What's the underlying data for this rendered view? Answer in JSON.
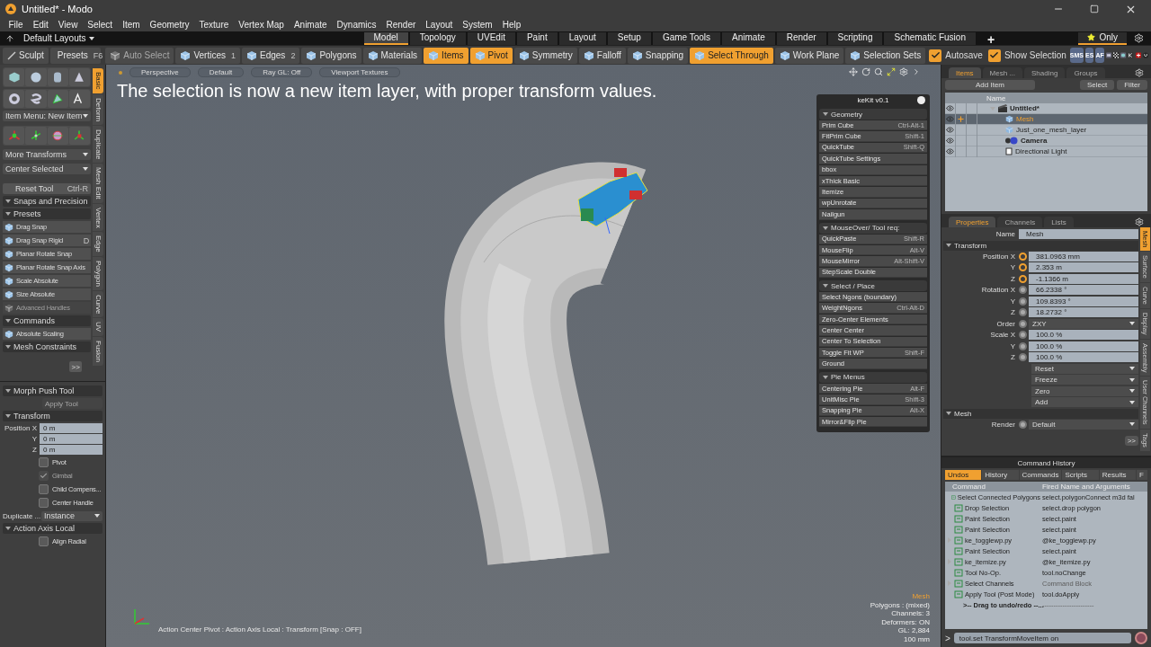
{
  "window": {
    "title": "Untitled* - Modo"
  },
  "menu": [
    "File",
    "Edit",
    "View",
    "Select",
    "Item",
    "Geometry",
    "Texture",
    "Vertex Map",
    "Animate",
    "Dynamics",
    "Render",
    "Layout",
    "System",
    "Help"
  ],
  "layout_bar": {
    "layouts": "Default Layouts",
    "tabs": [
      {
        "label": "Model",
        "selected": true
      },
      {
        "label": "Topology",
        "selected": false
      },
      {
        "label": "UVEdit",
        "selected": false
      },
      {
        "label": "Paint",
        "selected": false
      },
      {
        "label": "Layout",
        "selected": false
      },
      {
        "label": "Setup",
        "selected": false
      },
      {
        "label": "Game Tools",
        "selected": false
      },
      {
        "label": "Animate",
        "selected": false
      },
      {
        "label": "Render",
        "selected": false
      },
      {
        "label": "Scripting",
        "selected": false
      },
      {
        "label": "Schematic Fusion",
        "selected": false
      }
    ],
    "add": "+",
    "only": "Only"
  },
  "left_toolbar": [
    {
      "label": "Sculpt"
    },
    {
      "label": "Presets",
      "shortcut": "F6"
    }
  ],
  "toolbar": [
    {
      "label": "Auto Select",
      "selected": false,
      "disabled": true
    },
    {
      "label": "Vertices",
      "shortcut": "1",
      "selected": false,
      "disabled": false
    },
    {
      "label": "Edges",
      "shortcut": "2",
      "selected": false,
      "disabled": false
    },
    {
      "label": "Polygons",
      "selected": false,
      "disabled": false
    },
    {
      "label": "Materials",
      "selected": false,
      "disabled": false
    },
    {
      "label": "Items",
      "selected": true,
      "disabled": false
    },
    {
      "label": "Pivot",
      "selected": true,
      "disabled": false
    },
    {
      "label": "Symmetry",
      "selected": false,
      "disabled": false
    },
    {
      "label": "Falloff",
      "selected": false,
      "disabled": false
    },
    {
      "label": "Snapping",
      "selected": false,
      "disabled": false
    },
    {
      "label": "Select Through",
      "selected": true,
      "disabled": false
    },
    {
      "label": "Work Plane",
      "selected": false,
      "disabled": false
    },
    {
      "label": "Selection Sets",
      "selected": false,
      "disabled": false
    }
  ],
  "toggles": [
    {
      "label": "Autosave",
      "checked": true
    },
    {
      "label": "Show Selection",
      "checked": true
    }
  ],
  "icon_buttons": [
    "SMS",
    "ES",
    "AF"
  ],
  "left_panel": {
    "item_menu": "Item Menu: New Item",
    "dropdowns": [
      "More Transforms",
      "Center Selected"
    ],
    "reset": {
      "label": "Reset Tool",
      "shortcut": "Ctrl-R"
    },
    "tools": [
      {
        "kind": "header",
        "label": "Snaps and Precision"
      },
      {
        "kind": "header",
        "label": "Presets"
      },
      {
        "kind": "item",
        "label": "Drag Snap",
        "disabled": false
      },
      {
        "kind": "item",
        "label": "Drag Snap Rigid",
        "shortcut": "D",
        "disabled": false
      },
      {
        "kind": "item",
        "label": "Planar Rotate Snap",
        "disabled": false
      },
      {
        "kind": "item",
        "label": "Planar Rotate Snap Axis",
        "disabled": false
      },
      {
        "kind": "item",
        "label": "Scale Absolute",
        "disabled": false
      },
      {
        "kind": "item",
        "label": "Size Absolute",
        "disabled": false
      },
      {
        "kind": "item",
        "label": "Advanced Handles",
        "disabled": true
      },
      {
        "kind": "header",
        "label": "Commands"
      },
      {
        "kind": "item",
        "label": "Absolute Scaling",
        "disabled": false
      },
      {
        "kind": "header",
        "label": "Mesh Constraints"
      }
    ],
    "more": ">>",
    "tabs": [
      {
        "label": "Basic",
        "selected": true
      },
      {
        "label": "Deform",
        "selected": false
      },
      {
        "label": "Duplicate",
        "selected": false
      },
      {
        "label": "Mesh Edit",
        "selected": false
      },
      {
        "label": "Vertex",
        "selected": false
      },
      {
        "label": "Edge",
        "selected": false
      },
      {
        "label": "Polygon",
        "selected": false
      },
      {
        "label": "Curve",
        "selected": false
      },
      {
        "label": "UV",
        "selected": false
      },
      {
        "label": "Fusion",
        "selected": false
      }
    ],
    "tool_props": {
      "title": "Morph Push Tool",
      "apply": "Apply Tool",
      "transform": "Transform",
      "position": [
        {
          "label": "Position X",
          "value": "0 m"
        },
        {
          "label": "Y",
          "value": "0 m"
        },
        {
          "label": "Z",
          "value": "0 m"
        }
      ],
      "checks": [
        {
          "label": "Pivot",
          "checked": false,
          "disabled": false
        },
        {
          "label": "Gimbal",
          "checked": true,
          "disabled": true
        },
        {
          "label": "Child Compens...",
          "checked": false,
          "disabled": false
        },
        {
          "label": "Center Handle",
          "checked": false,
          "disabled": false
        }
      ],
      "duplicate": {
        "label": "Duplicate ...",
        "value": "Instance"
      },
      "axis_title": "Action Axis Local",
      "align": {
        "label": "Align Radial",
        "checked": false
      }
    }
  },
  "viewport": {
    "header": [
      "Perspective",
      "Default",
      "Ray GL: Off",
      "Viewport Textures"
    ],
    "caption": "The selection is now a new item layer, with proper transform values.",
    "status": "Action Center Pivot : Action Axis Local : Transform  [Snap : OFF]",
    "stats": [
      "Mesh",
      "Polygons : (mixed)",
      "Channels: 3",
      "Deformers: ON",
      "GL: 2,884",
      "100 mm"
    ]
  },
  "kit": {
    "title": "keKit v0.1",
    "sections": [
      {
        "title": "Geometry",
        "items": [
          {
            "label": "Prim Cube",
            "shortcut": "Ctrl-Alt-1"
          },
          {
            "label": "FitPrim Cube",
            "shortcut": "Shift-1"
          },
          {
            "label": "QuickTube",
            "shortcut": "Shift-Q"
          },
          {
            "label": "QuickTube Settings"
          },
          {
            "label": "bbox"
          },
          {
            "label": "xThick Basic"
          },
          {
            "label": "Itemize"
          },
          {
            "label": "wpUnrotate"
          },
          {
            "label": "Nailgun"
          }
        ]
      },
      {
        "title": "MouseOver/ Tool req:",
        "items": [
          {
            "label": "QuickPaste",
            "shortcut": "Shift-R"
          },
          {
            "label": "MouseFlip",
            "shortcut": "Alt-V"
          },
          {
            "label": "MouseMirror",
            "shortcut": "Alt-Shift-V"
          },
          {
            "label": "StepScale Double"
          }
        ]
      },
      {
        "title": "Select / Place",
        "items": [
          {
            "label": "Select Ngons (boundary)"
          },
          {
            "label": "WeightNgons",
            "shortcut": "Ctrl-Alt-D"
          },
          {
            "label": "Zero-Center Elements"
          },
          {
            "label": "Center Center"
          },
          {
            "label": "Center To Selection"
          },
          {
            "label": "Toggle Fit WP",
            "shortcut": "Shift-F"
          },
          {
            "label": "Ground"
          }
        ]
      },
      {
        "title": "Pie Menus",
        "items": [
          {
            "label": "Centering Pie",
            "shortcut": "Alt-F"
          },
          {
            "label": "UnitMisc Pie",
            "shortcut": "Shift-3"
          },
          {
            "label": "Snapping Pie",
            "shortcut": "Alt-X"
          },
          {
            "label": "Mirror&Flip Pie"
          }
        ]
      }
    ]
  },
  "items_panel": {
    "tabs": [
      {
        "label": "Items",
        "selected": true
      },
      {
        "label": "Mesh ...",
        "selected": false
      },
      {
        "label": "Shading",
        "selected": false
      },
      {
        "label": "Groups",
        "selected": false
      }
    ],
    "add_item": "Add Item",
    "select": "Select",
    "filter": "Filter",
    "name_column": "Name",
    "tree": [
      {
        "label": "Untitled*",
        "kind": "scene",
        "bold": true,
        "selected": false,
        "children": [
          {
            "label": "Mesh",
            "kind": "mesh",
            "bold": false,
            "selected": true
          },
          {
            "label": "Just_one_mesh_layer",
            "kind": "mesh",
            "bold": false,
            "selected": false
          },
          {
            "label": "Camera",
            "kind": "camera",
            "bold": true,
            "selected": false
          },
          {
            "label": "Directional Light",
            "kind": "light",
            "bold": false,
            "selected": false
          }
        ]
      }
    ]
  },
  "properties": {
    "tabs": [
      {
        "label": "Properties",
        "selected": true
      },
      {
        "label": "Channels",
        "selected": false
      },
      {
        "label": "Lists",
        "selected": false
      }
    ],
    "name": {
      "label": "Name",
      "value": "Mesh"
    },
    "section": "Transform",
    "groups": [
      {
        "keyed": true,
        "rows": [
          {
            "label": "Position X",
            "value": "381.0963 mm"
          },
          {
            "label": "Y",
            "value": "2.353 m"
          },
          {
            "label": "Z",
            "value": "-1.1366 m"
          }
        ]
      },
      {
        "keyed": false,
        "rows": [
          {
            "label": "Rotation X",
            "value": "66.2338 °"
          },
          {
            "label": "Y",
            "value": "109.8393 °"
          },
          {
            "label": "Z",
            "value": "18.2732 °"
          }
        ]
      }
    ],
    "order": {
      "label": "Order",
      "value": "ZXY"
    },
    "scale": [
      {
        "label": "Scale X",
        "value": "100.0 %"
      },
      {
        "label": "Y",
        "value": "100.0 %"
      },
      {
        "label": "Z",
        "value": "100.0 %"
      }
    ],
    "actions": [
      "Reset",
      "Freeze",
      "Zero",
      "Add"
    ],
    "mesh_section": "Mesh",
    "render": {
      "label": "Render",
      "value": "Default"
    },
    "more": ">>",
    "side_tabs": [
      {
        "label": "Mesh",
        "selected": true
      },
      {
        "label": "Surface",
        "selected": false
      },
      {
        "label": "Curve",
        "selected": false
      },
      {
        "label": "Display",
        "selected": false
      },
      {
        "label": "Assembly",
        "selected": false
      },
      {
        "label": "User Channels",
        "selected": false
      },
      {
        "label": "Tags",
        "selected": false
      }
    ]
  },
  "history": {
    "title": "Command History",
    "tabs": [
      {
        "label": "Undos",
        "selected": true
      },
      {
        "label": "History",
        "selected": false
      },
      {
        "label": "Commands",
        "selected": false
      },
      {
        "label": "Scripts",
        "selected": false
      },
      {
        "label": "Results",
        "selected": false
      },
      {
        "label": "F",
        "selected": false
      }
    ],
    "columns": [
      "Command",
      "Fired Name and Arguments"
    ],
    "rows": [
      {
        "command": "Select Connected Polygons",
        "fired": "select.polygonConnect m3d fal",
        "expandable": false,
        "dim": false
      },
      {
        "command": "Drop Selection",
        "fired": "select.drop polygon",
        "expandable": false,
        "dim": false
      },
      {
        "command": "Paint Selection",
        "fired": "select.paint",
        "expandable": false,
        "dim": false
      },
      {
        "command": "Paint Selection",
        "fired": "select.paint",
        "expandable": false,
        "dim": false
      },
      {
        "command": "ke_togglewp.py",
        "fired": "@ke_togglewp.py",
        "expandable": true,
        "dim": false
      },
      {
        "command": "Paint Selection",
        "fired": "select.paint",
        "expandable": false,
        "dim": false
      },
      {
        "command": "ke_itemize.py",
        "fired": "@ke_itemize.py",
        "expandable": true,
        "dim": false
      },
      {
        "command": "Tool No-Op.",
        "fired": "tool.noChange",
        "expandable": false,
        "dim": false
      },
      {
        "command": "Select Channels",
        "fired": "Command Block",
        "expandable": true,
        "dim": true
      },
      {
        "command": "Apply Tool (Post Mode)",
        "fired": "tool.doApply",
        "expandable": false,
        "dim": false
      }
    ],
    "drag_row": {
      "command": ">-- Drag to undo/redo --...",
      "fired": "-----------------------"
    },
    "prompt": ">",
    "input": "tool.set TransformMoveItem on"
  }
}
